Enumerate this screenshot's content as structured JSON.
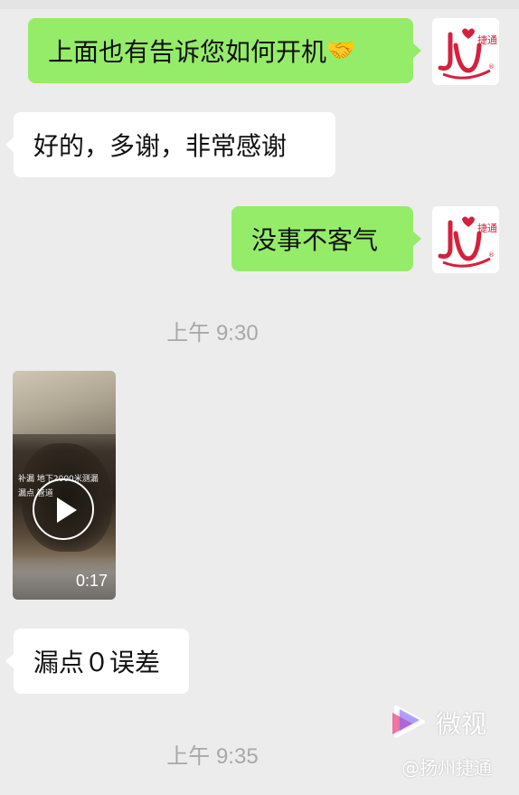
{
  "messages": [
    {
      "side": "right",
      "text": "上面也有告诉您如何开机",
      "emoji": "🤝"
    },
    {
      "side": "left",
      "text": "好的，多谢，非常感谢"
    },
    {
      "side": "right",
      "text": "没事不客气"
    },
    {
      "side": "left",
      "text": "漏点０误差"
    }
  ],
  "avatar": {
    "brand_text": "捷通",
    "mark": "®",
    "icon": "company-logo"
  },
  "timestamps": [
    "上午 9:30",
    "上午 9:35"
  ],
  "video": {
    "duration": "0:17",
    "caption_line1": "补漏 地下2000米测漏",
    "caption_line2": "漏点 管道"
  },
  "watermark": {
    "app": "微视",
    "handle": "@扬州捷通"
  },
  "colors": {
    "background": "#ececec",
    "sent_bubble": "#95ec69",
    "received_bubble": "#ffffff",
    "brand_red": "#d4213d"
  }
}
